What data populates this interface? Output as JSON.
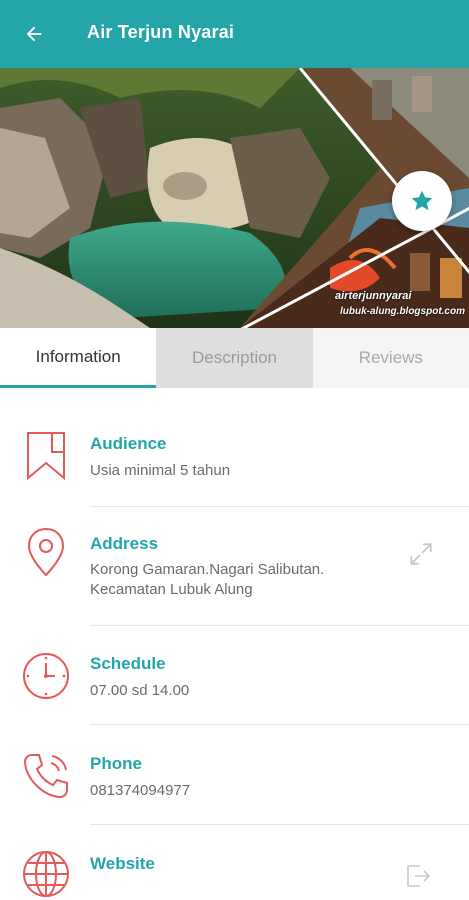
{
  "appbar": {
    "title": "Air Terjun Nyarai",
    "back_icon": "arrow-left-icon"
  },
  "hero": {
    "watermark_handle": "airterjunnyarai",
    "watermark_site": "lubuk-alung.blogspot.com",
    "fav_icon": "star-icon"
  },
  "tabs": [
    {
      "label": "Information",
      "active": true
    },
    {
      "label": "Description",
      "active": false
    },
    {
      "label": "Reviews",
      "active": false
    }
  ],
  "info": {
    "audience": {
      "label": "Audience",
      "value": "Usia minimal 5 tahun",
      "icon": "bookmark-icon"
    },
    "address": {
      "label": "Address",
      "value": "Korong Gamaran.Nagari Salibutan.\nKecamatan Lubuk Alung",
      "icon": "location-pin-icon",
      "action_icon": "expand-icon"
    },
    "schedule": {
      "label": "Schedule",
      "value": "07.00 sd 14.00",
      "icon": "clock-icon"
    },
    "phone": {
      "label": "Phone",
      "value": "081374094977",
      "icon": "phone-icon"
    },
    "website": {
      "label": "Website",
      "value": "",
      "icon": "globe-icon",
      "action_icon": "open-external-icon"
    }
  },
  "colors": {
    "primary": "#24a6a9",
    "icon_red": "#e35a5a",
    "tab_inactive": "#dedede"
  }
}
